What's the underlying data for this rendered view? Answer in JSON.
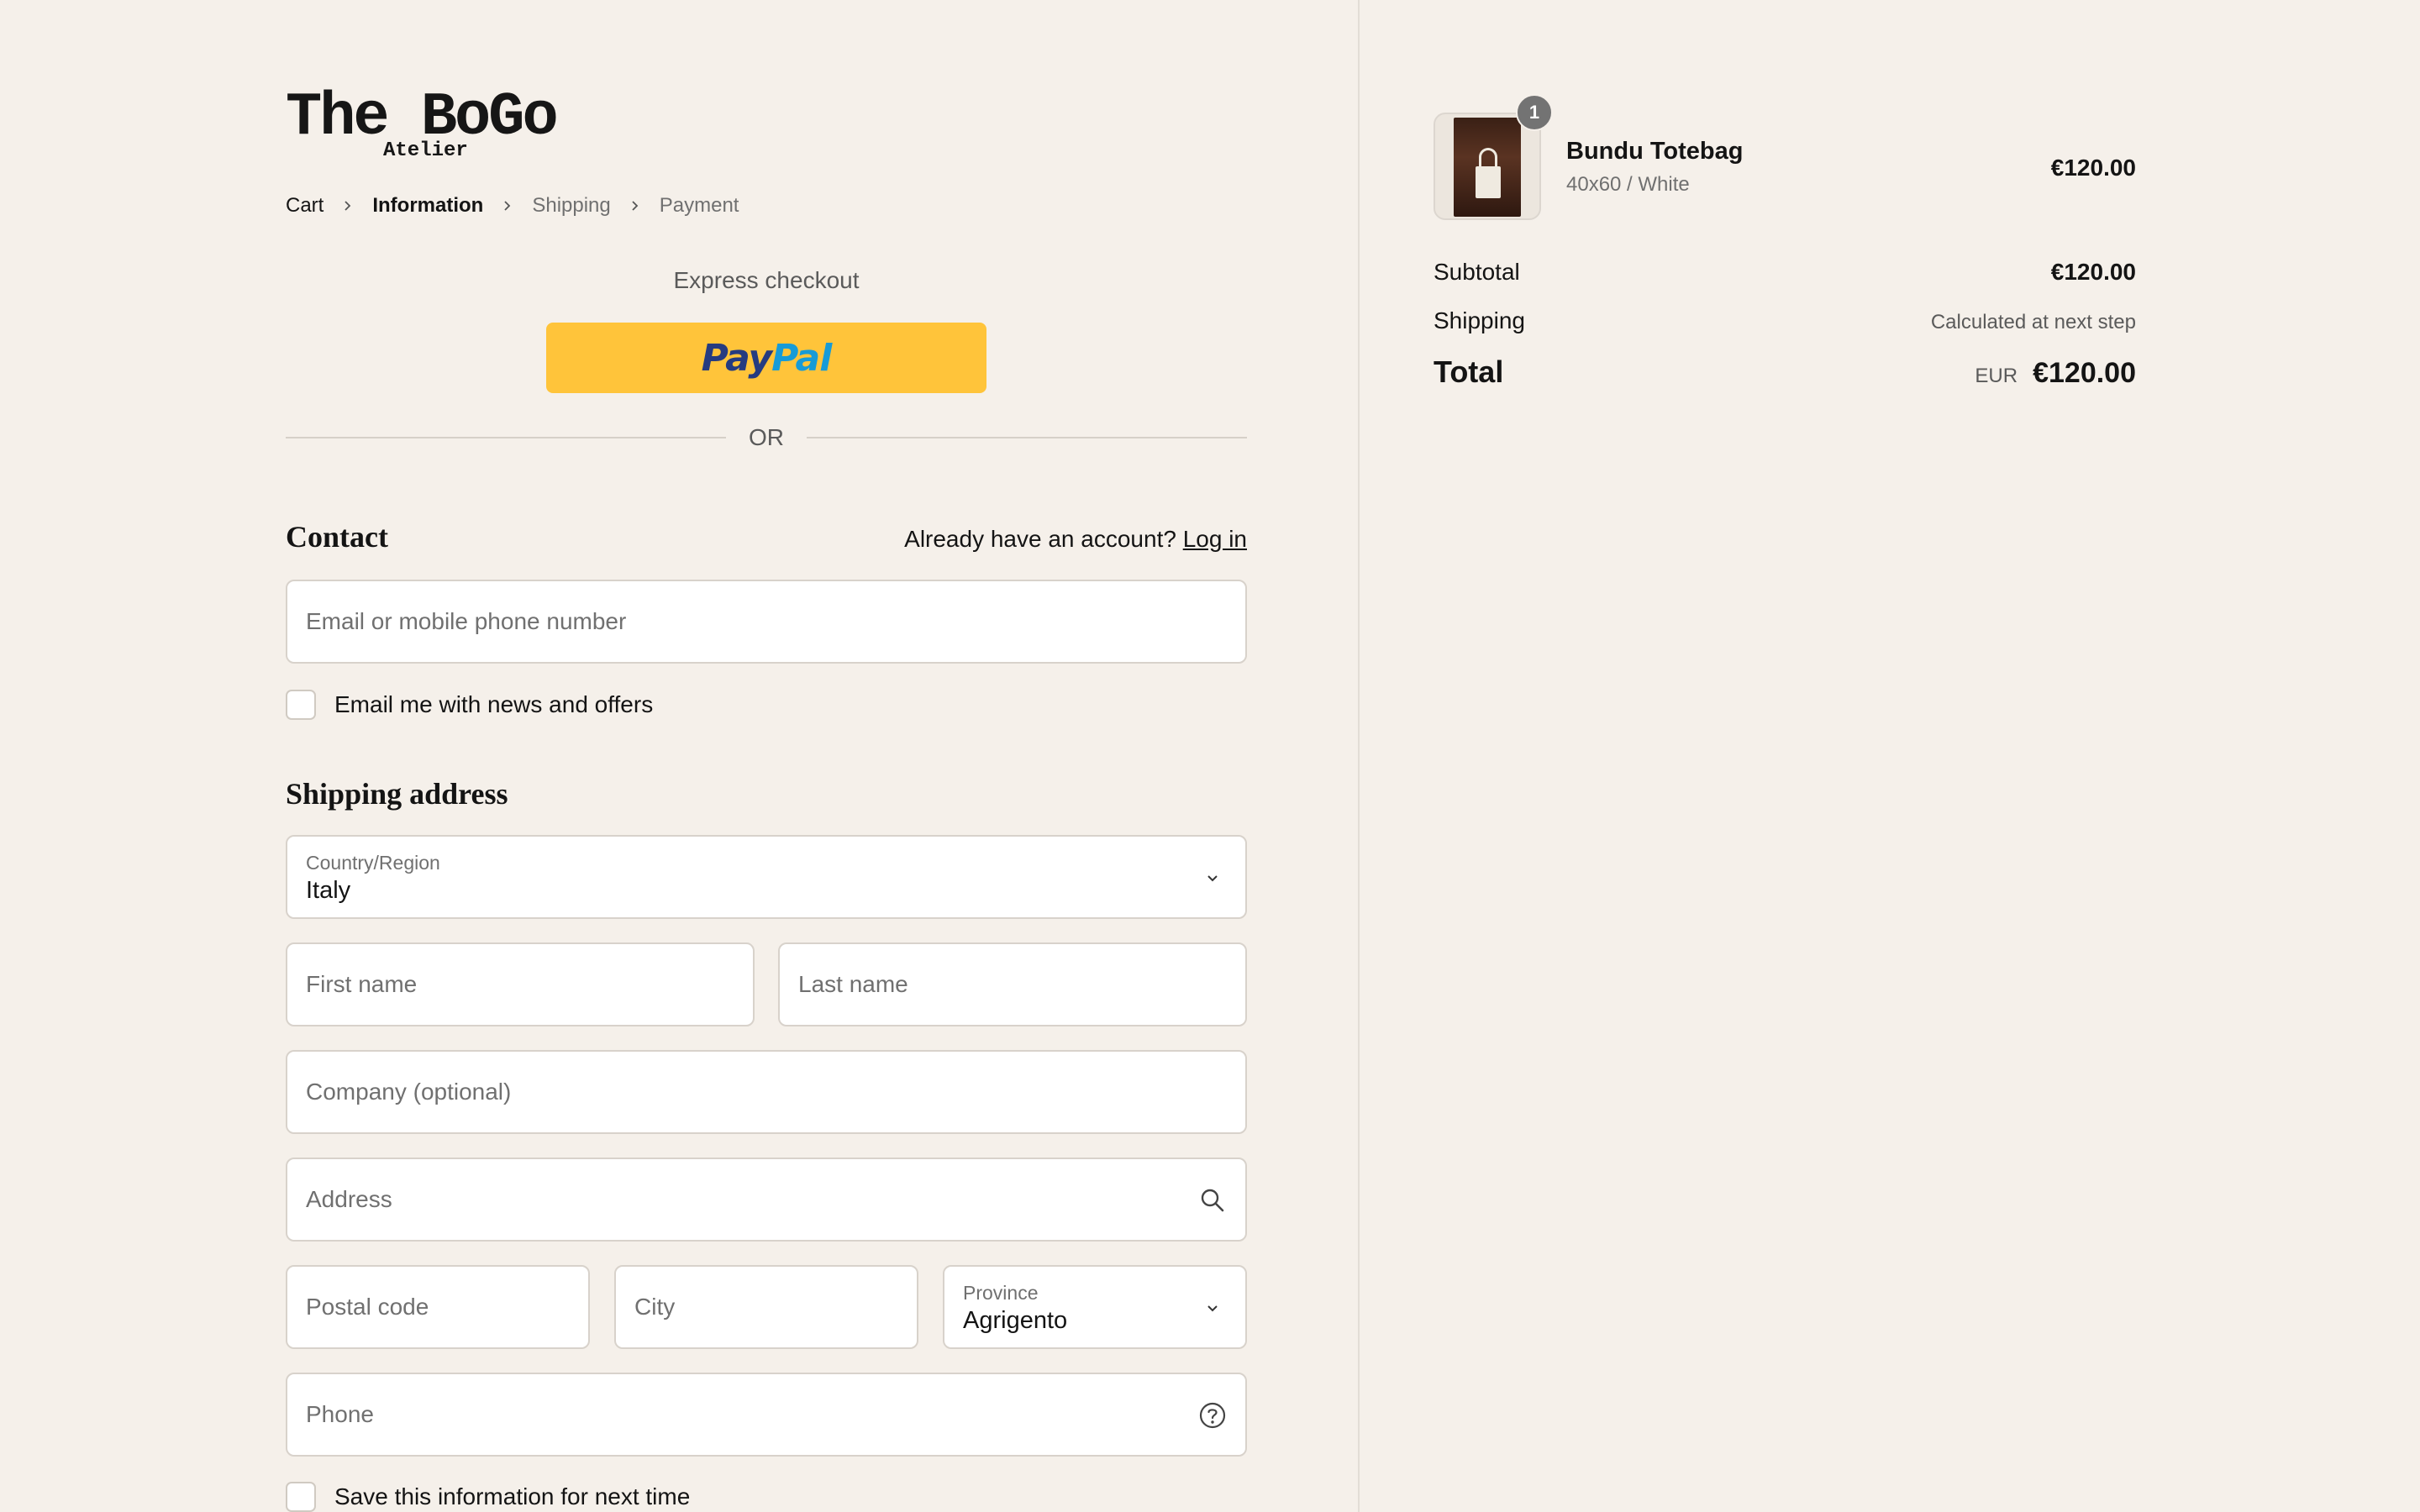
{
  "brand": {
    "name": "The BoGo",
    "subtitle": "Atelier"
  },
  "breadcrumb": [
    "Cart",
    "Information",
    "Shipping",
    "Payment"
  ],
  "express": {
    "title": "Express checkout",
    "paypal_part1": "Pay",
    "paypal_part2": "Pal",
    "or": "OR"
  },
  "contact": {
    "title": "Contact",
    "account_prompt": "Already have an account?",
    "login_link": "Log in",
    "email_placeholder": "Email or mobile phone number",
    "news_label": "Email me with news and offers"
  },
  "shipping": {
    "title": "Shipping address",
    "country_label": "Country/Region",
    "country_value": "Italy",
    "first_name_placeholder": "First name",
    "last_name_placeholder": "Last name",
    "company_placeholder": "Company (optional)",
    "address_placeholder": "Address",
    "postal_placeholder": "Postal code",
    "city_placeholder": "City",
    "province_label": "Province",
    "province_value": "Agrigento",
    "phone_placeholder": "Phone",
    "save_label": "Save this information for next time"
  },
  "summary": {
    "item": {
      "name": "Bundu Totebag",
      "variant": "40x60 / White",
      "price": "€120.00",
      "quantity": "1"
    },
    "subtotal_label": "Subtotal",
    "subtotal_value": "€120.00",
    "shipping_label": "Shipping",
    "shipping_value": "Calculated at next step",
    "total_label": "Total",
    "total_currency": "EUR",
    "total_value": "€120.00"
  },
  "colors": {
    "background": "#f5f0ea",
    "paypal": "#ffc43a",
    "text": "#141414",
    "muted": "#707070"
  }
}
